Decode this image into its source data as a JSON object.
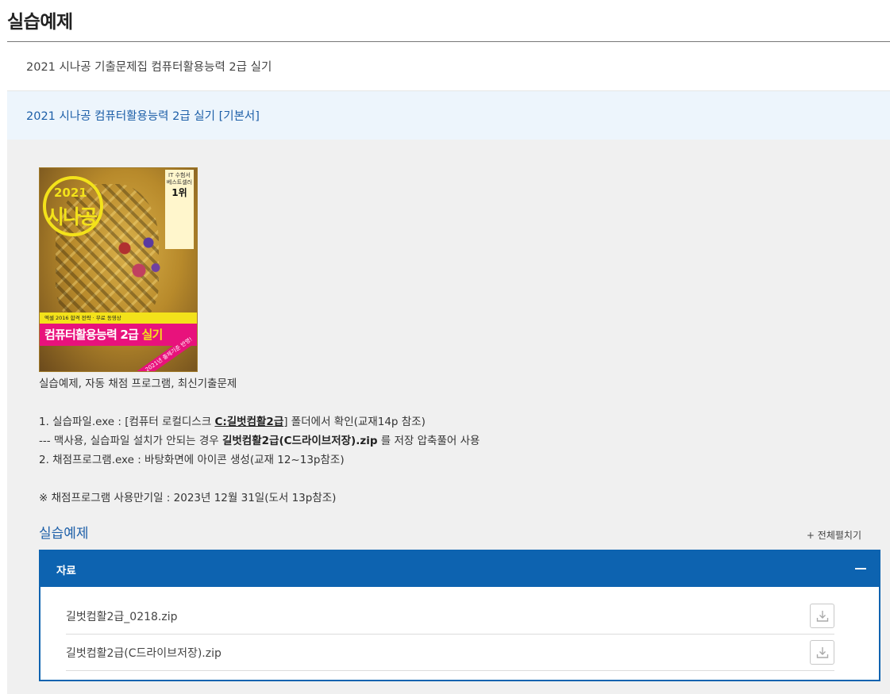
{
  "page": {
    "title": "실습예제"
  },
  "book": {
    "title": "2021 시나공 기출문제집 컴퓨터활용능력 2급 실기",
    "selected_item": "2021 시나공 컴퓨터활용능력 2급 실기 [기본서]"
  },
  "cover": {
    "year": "2021",
    "brand": "시나공",
    "badge_line1": "IT 수험서",
    "badge_line2": "베스트셀러",
    "badge_rank": "1위",
    "strip_top": "엑셀 2016    합격 전략 · 무료 동영상",
    "main_title_prefix": "컴퓨터활용능력 2급 ",
    "main_title_highlight": "실기",
    "ribbon": "2021년 출제기준 반영!"
  },
  "description": {
    "summary": "실습예제, 자동 채점 프로그램, 최신기출문제",
    "item1_prefix": "1. 실습파일.exe :  [컴퓨터 로컬디스크 ",
    "item1_path": "C:길벗컴활2급",
    "item1_suffix": "] 폴더에서 확인(교재14p 참조)",
    "item1_note_prefix": " --- 맥사용, 실습파일 설치가 안되는 경우 ",
    "item1_note_file": "길벗컴활2급(C드라이브저장).zip",
    "item1_note_suffix": " 를 저장 압축풀어 사용",
    "item2": "2. 채점프로그램.exe : 바탕화면에 아이콘 생성(교재 12~13p참조)",
    "notice": "※ 채점프로그램 사용만기일 :  2023년 12월 31일(도서 13p참조)"
  },
  "section": {
    "title": "실습예제",
    "expand_all": "+ 전체펼치기"
  },
  "accordion": {
    "header": "자료",
    "files": [
      {
        "name": "길벗컴활2급_0218.zip"
      },
      {
        "name": "길벗컴활2급(C드라이브저장).zip"
      }
    ]
  },
  "colors": {
    "accent": "#0d63b0",
    "link": "#1d5fa8",
    "selected_bg": "#edf5fc",
    "panel_bg": "#f0f0f0"
  }
}
